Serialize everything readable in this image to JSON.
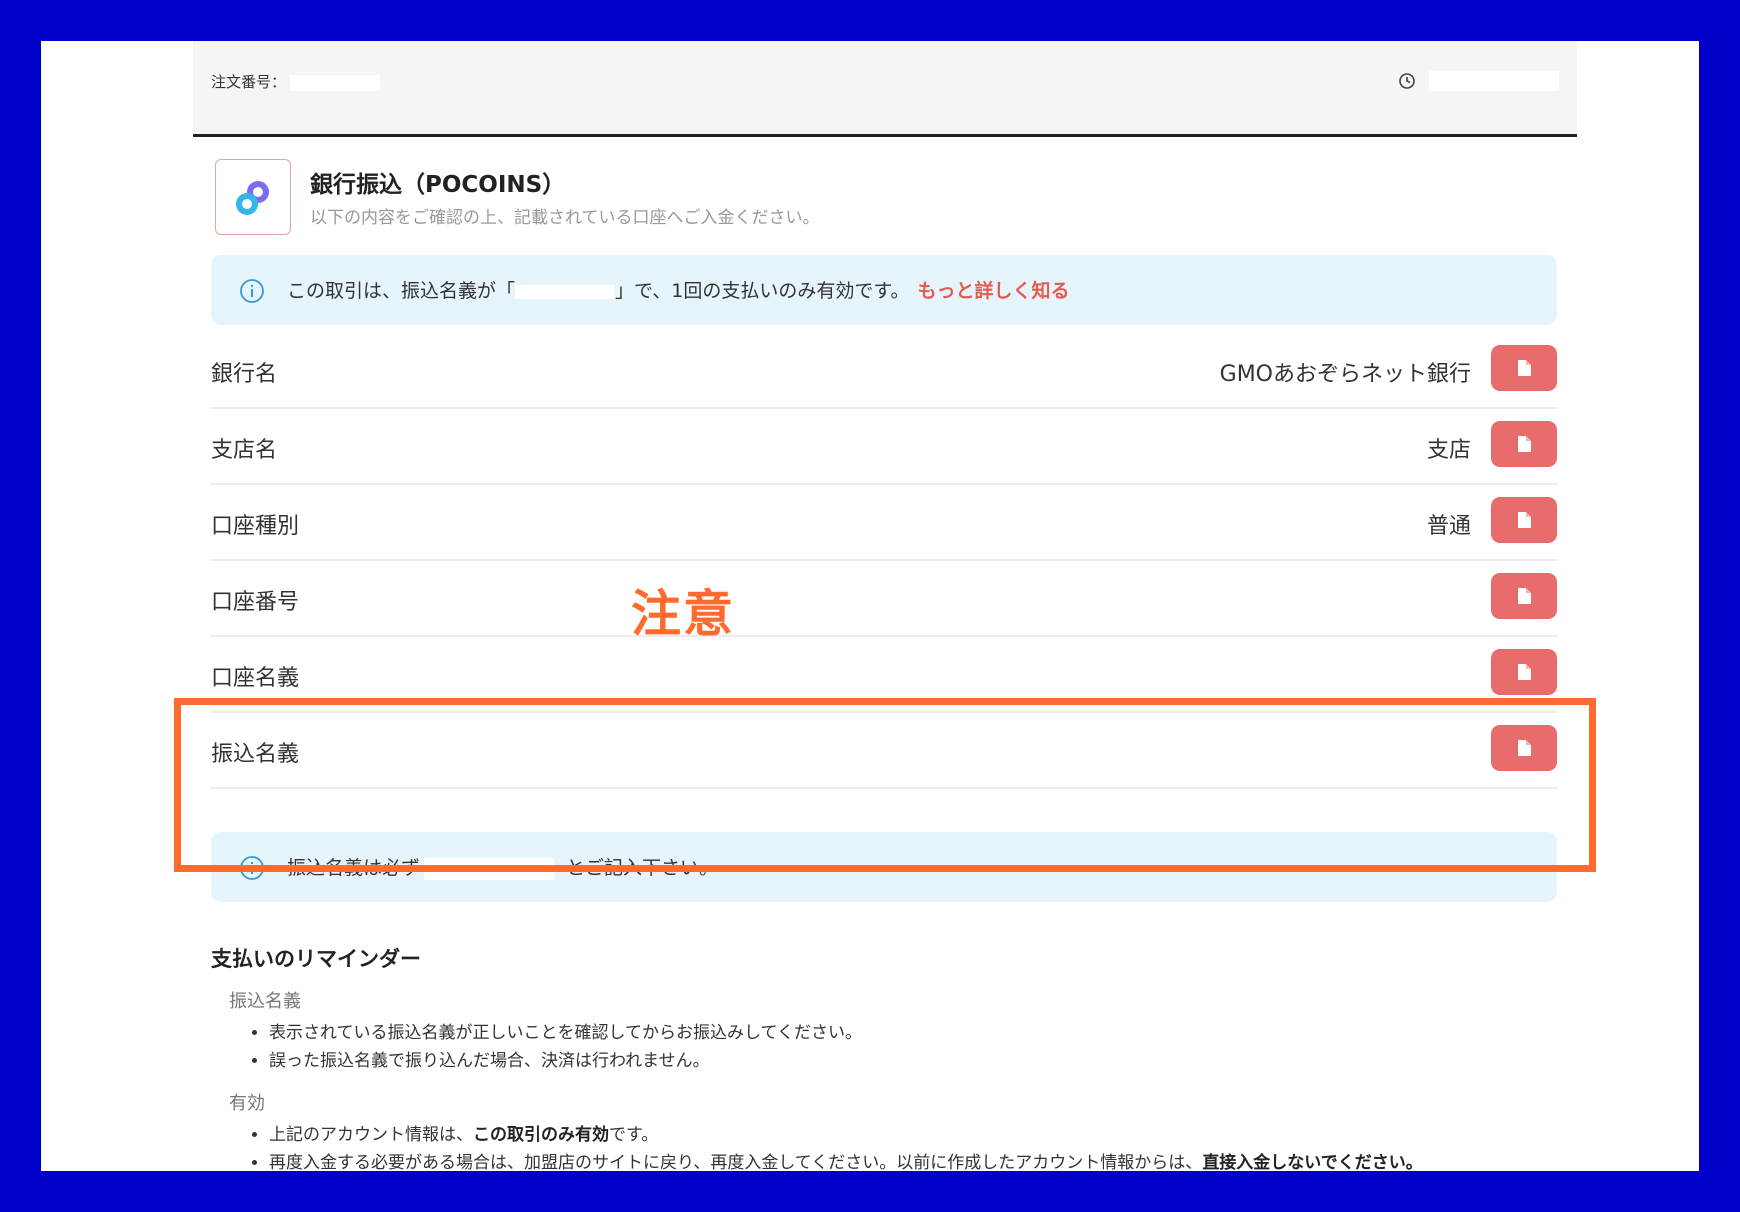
{
  "header": {
    "order_label": "注文番号：",
    "clock_icon": "clock-icon"
  },
  "method": {
    "title": "銀行振込（POCOINS）",
    "subtitle": "以下の内容をご確認の上、記載されている口座へご入金ください。",
    "logo_icon": "link-chain-icon"
  },
  "notice": {
    "text_before": "この取引は、振込名義が「",
    "text_after": "」で、1回の支払いのみ有効です。",
    "link": "もっと詳しく知る"
  },
  "rows": [
    {
      "label": "銀行名",
      "value": "GMOあおぞらネット銀行"
    },
    {
      "label": "支店名",
      "value": "支店"
    },
    {
      "label": "口座種別",
      "value": "普通"
    },
    {
      "label": "口座番号",
      "value": ""
    },
    {
      "label": "口座名義",
      "value": ""
    },
    {
      "label": "振込名義",
      "value": ""
    }
  ],
  "warning_label": "注意",
  "transfer_note": {
    "before": "振込名義は必ず",
    "after": "とご記入下さい。"
  },
  "reminder": {
    "title": "支払いのリマインダー",
    "sections": [
      {
        "heading": "振込名義",
        "items": [
          "表示されている振込名義が正しいことを確認してからお振込みしてください。",
          "誤った振込名義で振り込んだ場合、決済は行われません。"
        ]
      },
      {
        "heading": "有効",
        "item1_before": "上記のアカウント情報は、",
        "item1_bold": "この取引のみ有効",
        "item1_after": "です。",
        "item2_before": "再度入金する必要がある場合は、加盟店のサイトに戻り、再度入金してください。以前に作成したアカウント情報からは、",
        "item2_bold": "直接入金しないでください。"
      }
    ]
  },
  "colors": {
    "accent": "#e86c6c",
    "highlight": "#ff6a2f",
    "info_bg": "#e6f4fb",
    "backdrop": "#0000c8"
  }
}
